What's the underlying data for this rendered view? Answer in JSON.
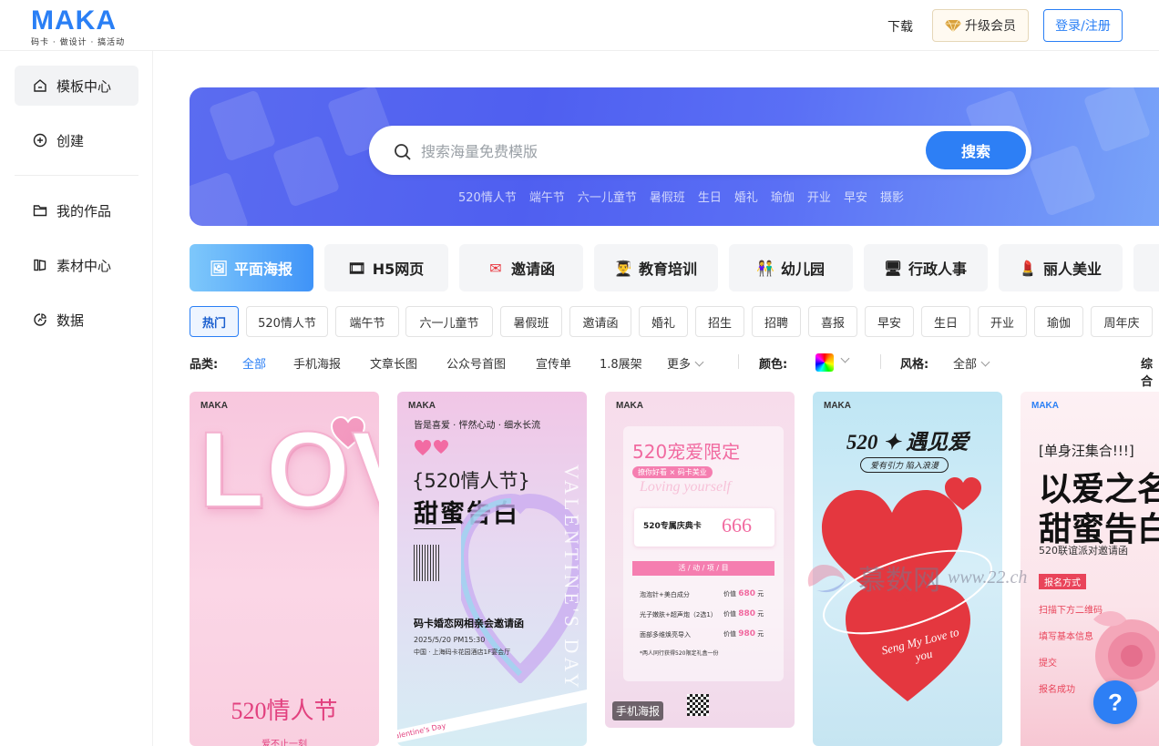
{
  "header": {
    "logo": "MAKA",
    "logo_sub": "码卡 · 做设计 · 搞活动",
    "download": "下载",
    "vip": "升级会员",
    "login": "登录/注册"
  },
  "sidebar": {
    "items": [
      {
        "label": "模板中心",
        "icon": "home-icon"
      },
      {
        "label": "创建",
        "icon": "plus-circle-icon"
      },
      {
        "label": "我的作品",
        "icon": "folder-icon"
      },
      {
        "label": "素材中心",
        "icon": "library-icon"
      },
      {
        "label": "数据",
        "icon": "chart-icon"
      }
    ]
  },
  "search": {
    "placeholder": "搜索海量免费模版",
    "button": "搜索",
    "hot": [
      "520情人节",
      "端午节",
      "六一儿童节",
      "暑假班",
      "生日",
      "婚礼",
      "瑜伽",
      "开业",
      "早安",
      "摄影"
    ]
  },
  "categories": [
    {
      "label": "平面海报",
      "emoji": "🖼"
    },
    {
      "label": "H5网页",
      "emoji": "🎞"
    },
    {
      "label": "邀请函",
      "emoji": "✉"
    },
    {
      "label": "教育培训",
      "emoji": "👨‍🎓"
    },
    {
      "label": "幼儿园",
      "emoji": "👫"
    },
    {
      "label": "行政人事",
      "emoji": "🖥"
    },
    {
      "label": "丽人美业",
      "emoji": "💄"
    }
  ],
  "tags": [
    "热门",
    "520情人节",
    "端午节",
    "六一儿童节",
    "暑假班",
    "邀请函",
    "婚礼",
    "招生",
    "招聘",
    "喜报",
    "早安",
    "生日",
    "开业",
    "瑜伽",
    "周年庆"
  ],
  "filters": {
    "category_label": "品类:",
    "category_options": [
      "全部",
      "手机海报",
      "文章长图",
      "公众号首图",
      "宣传单",
      "1.8展架",
      "更多"
    ],
    "color_label": "颜色:",
    "style_label": "风格:",
    "style_value": "全部",
    "sort_label": "综合"
  },
  "cards": {
    "c1": {
      "brand": "MAKA",
      "big": "LOVE",
      "title": "520情人节",
      "foot": "爱不止一刻"
    },
    "c2": {
      "brand": "MAKA",
      "top": "皆是喜爱 · 怦然心动 · 细水长流",
      "subtitle": "{520情人节}",
      "title": "甜蜜告白",
      "side": "VALENTINE'S DAY",
      "event": "码卡婚恋网相亲会邀请函",
      "time": "2025/5/20 PM15:30",
      "place": "中国 · 上海码卡花园酒店1F宴会厅",
      "ribbon": "Valentine's Day"
    },
    "c3": {
      "brand": "MAKA",
      "title": "520宠爱限定",
      "tag": "撩你好看 × 码卡美业",
      "script": "Loving yourself",
      "card_label": "520专属庆典卡",
      "card_number": "666",
      "section": "活 / 动 / 项 / 目",
      "items": [
        {
          "name": "泡泡针+美白成分",
          "price": "680"
        },
        {
          "name": "光子嫩肤+超声炮（2选1）",
          "price": "880"
        },
        {
          "name": "面部多维焕亮导入",
          "price": "980"
        }
      ],
      "price_label": "价值",
      "price_unit": "元",
      "note": "*两人同行获得520限定礼盒一份",
      "badge": "手机海报"
    },
    "c4": {
      "brand": "MAKA",
      "title": "520 ✦ 遇见爱",
      "subtitle": "爱有引力 陷入浪漫",
      "script": "Seng My Love to you"
    },
    "c5": {
      "brand": "MAKA",
      "top": "[单身汪集合!!!]",
      "title1": "以爱之名",
      "title2": "甜蜜告白",
      "sub": "520联谊派对邀请函",
      "section": "报名方式",
      "steps": [
        "扫描下方二维码",
        "填写基本信息",
        "提交",
        "报名成功"
      ]
    }
  },
  "watermark": {
    "text": "慕数网",
    "url": "www.22.ch"
  },
  "fab": "?",
  "colors": {
    "primary": "#2d7ff5",
    "accent_pink": "#f16aa0",
    "red": "#e8343c"
  }
}
